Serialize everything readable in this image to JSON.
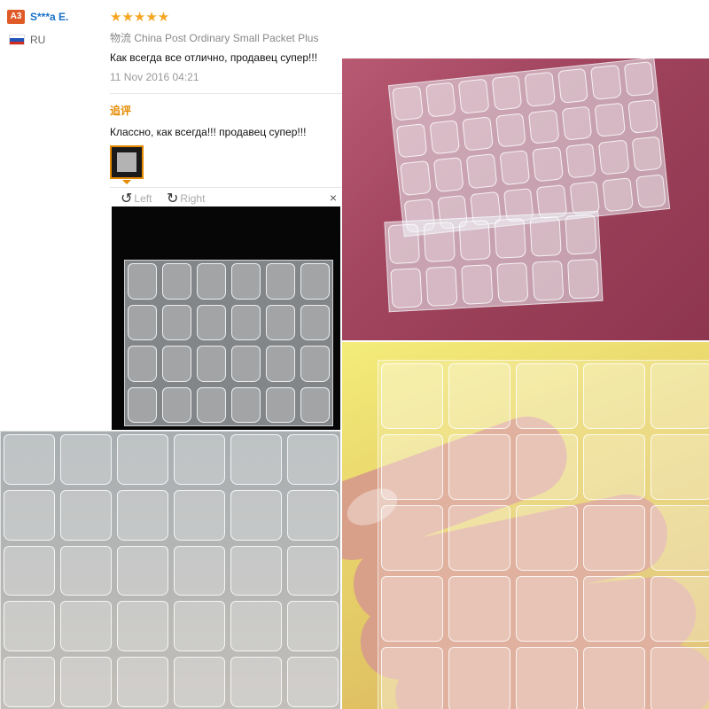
{
  "user": {
    "badge": "A3",
    "name": "S***a E.",
    "country": "RU",
    "flag_colors": [
      "#ffffff",
      "#2255b8",
      "#d52b1e"
    ]
  },
  "review": {
    "stars": "★★★★★",
    "logistics_label": "物流",
    "logistics_value": "China Post Ordinary Small Packet Plus",
    "text": "Как всегда все отлично, продавец супер!!!",
    "date": "11 Nov 2016 04:21",
    "additional_label": "追评",
    "additional_text": "Классно, как всегда!!! продавец супер!!!"
  },
  "viewer": {
    "rotate_left": "Left",
    "rotate_right": "Right",
    "close": "×"
  },
  "colors": {
    "accent_orange": "#e58a00",
    "star": "#f5a623",
    "name_link": "#1a73c7",
    "badge": "#e05a28"
  }
}
